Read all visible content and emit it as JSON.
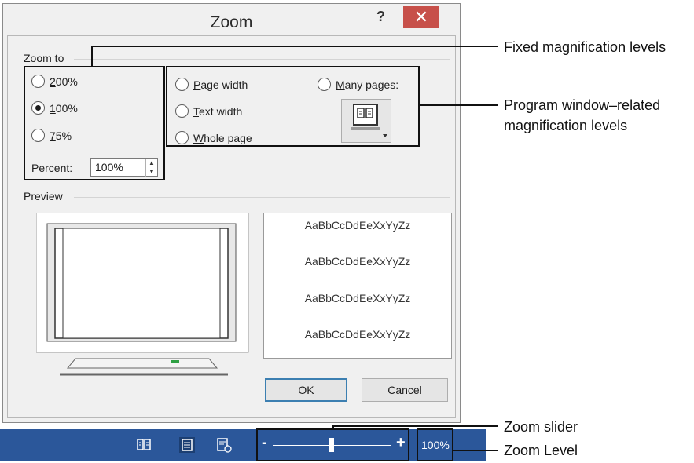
{
  "dialog": {
    "title": "Zoom",
    "help_label": "?",
    "close_label": "✕",
    "zoom_to": {
      "label": "Zoom to",
      "fixed_options": [
        {
          "label": "200%",
          "selected": false
        },
        {
          "label": "100%",
          "selected": true
        },
        {
          "label": "75%",
          "selected": false
        }
      ],
      "window_options": [
        {
          "label": "Page width",
          "selected": false
        },
        {
          "label": "Text width",
          "selected": false
        },
        {
          "label": "Whole page",
          "selected": false
        },
        {
          "label": "Many pages:",
          "selected": false
        }
      ],
      "many_pages_icon": "monitor-pages-icon",
      "percent_label": "Percent:",
      "percent_value": "100%"
    },
    "preview": {
      "label": "Preview",
      "sample_lines": [
        "AaBbCcDdEeXxYyZz",
        "AaBbCcDdEeXxYyZz",
        "AaBbCcDdEeXxYyZz",
        "AaBbCcDdEeXxYyZz"
      ]
    },
    "ok_label": "OK",
    "cancel_label": "Cancel"
  },
  "statusbar": {
    "view_icons": [
      "read-mode-icon",
      "print-layout-icon",
      "web-layout-icon"
    ],
    "zoom_minus": "-",
    "zoom_plus": "+",
    "zoom_level": "100%",
    "zoom_slider_fraction": 0.5
  },
  "callouts": {
    "fixed": "Fixed magnification levels",
    "window_line1": "Program window–related",
    "window_line2": "magnification levels",
    "slider": "Zoom slider",
    "level": "Zoom Level"
  },
  "colors": {
    "statusbar": "#2b579a",
    "close_button": "#c7504a",
    "dialog_bg": "#f0f0f0"
  }
}
